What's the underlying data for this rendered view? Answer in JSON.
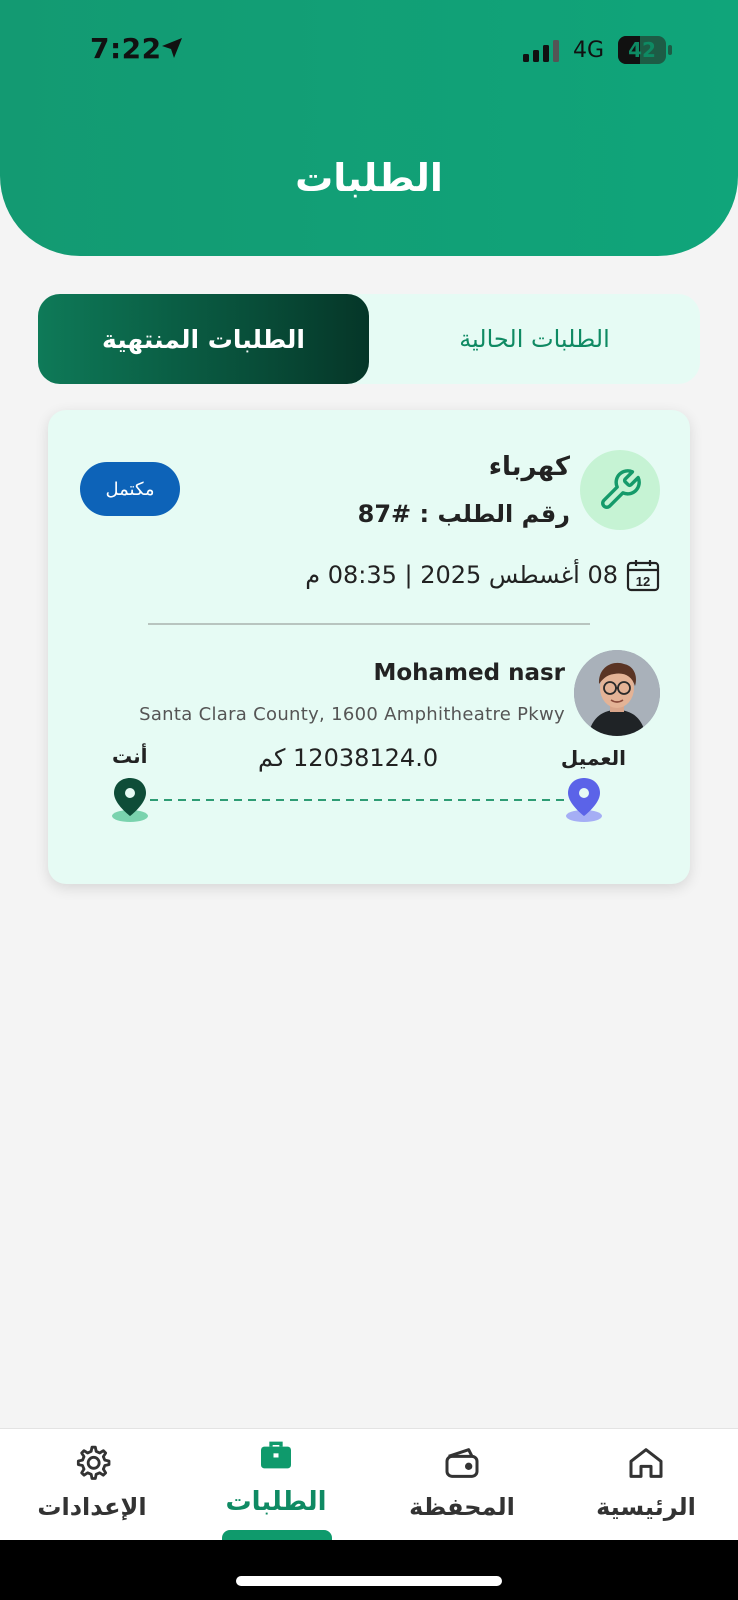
{
  "status_bar": {
    "time": "7:22",
    "network": "4G",
    "battery": "42"
  },
  "header": {
    "title": "الطلبات"
  },
  "tabs": {
    "current_label": "الطلبات الحالية",
    "finished_label": "الطلبات المنتهية",
    "active": "finished"
  },
  "order_card": {
    "service_name": "كهرباء",
    "order_number": "رقم الطلب : #87",
    "status": "مكتمل",
    "date": "08 أغسطس 2025 | 08:35 م",
    "client": {
      "name": "Mohamed nasr",
      "address": "Santa Clara County, 1600 Amphitheatre Pkwy"
    },
    "route": {
      "client_label": "العميل",
      "you_label": "أنت",
      "distance": "12038124.0 كم"
    }
  },
  "bottom_nav": {
    "items": [
      {
        "label": "الرئيسية",
        "icon": "home-icon"
      },
      {
        "label": "المحفظة",
        "icon": "wallet-icon"
      },
      {
        "label": "الطلبات",
        "icon": "briefcase-icon"
      },
      {
        "label": "الإعدادات",
        "icon": "gear-icon"
      }
    ],
    "active_index": 2
  },
  "colors": {
    "primary": "#10a57a",
    "dark_green": "#053628",
    "card_bg": "#e6fbf4",
    "badge_blue": "#0d63b8"
  }
}
